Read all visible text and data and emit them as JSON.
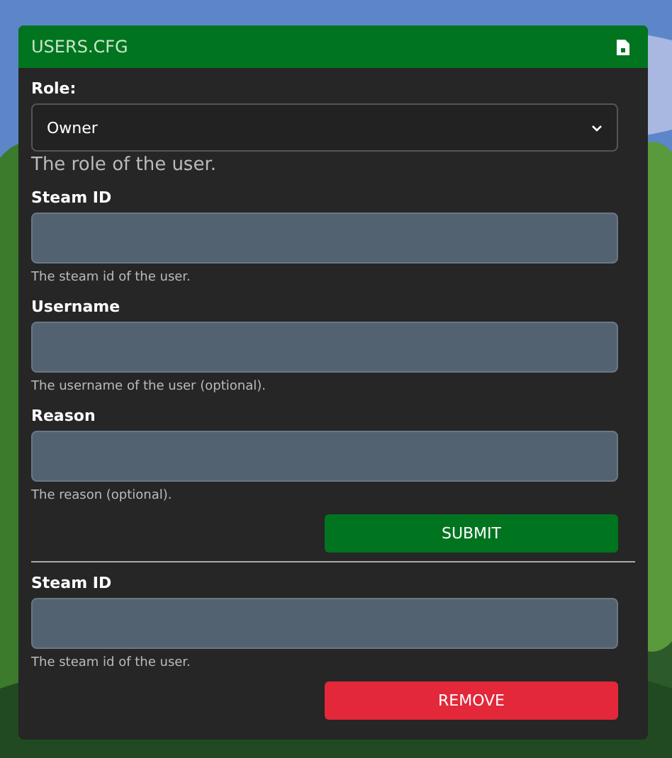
{
  "panel": {
    "title": "USERS.CFG"
  },
  "sections": [
    {
      "fields": [
        {
          "kind": "select",
          "label": "Role:",
          "value": "Owner",
          "help": "The role of the user."
        },
        {
          "kind": "text",
          "label": "Steam ID",
          "help": "The steam id of the user."
        },
        {
          "kind": "text",
          "label": "Username",
          "help": "The username of the user (optional)."
        },
        {
          "kind": "text",
          "label": "Reason",
          "help": "The reason (optional)."
        }
      ],
      "button": {
        "label": "SUBMIT",
        "kind": "submit"
      }
    },
    {
      "fields": [
        {
          "kind": "text",
          "label": "Steam ID",
          "help": "The steam id of the user."
        }
      ],
      "button": {
        "label": "REMOVE",
        "kind": "danger"
      }
    }
  ]
}
